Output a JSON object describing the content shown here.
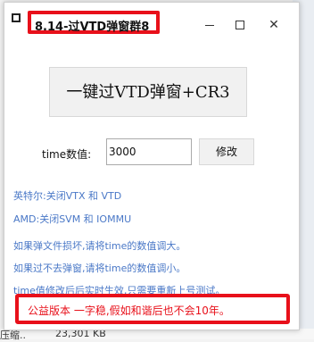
{
  "window": {
    "title": "8.14-过VTD弹窗群8",
    "minimize_icon": "minimize-icon",
    "maximize_icon": "maximize-icon",
    "close_icon": "close-icon",
    "close_glyph": "✕"
  },
  "main": {
    "bypass_button_label": "一键过VTD弹窗+CR3",
    "time_label": "time数值:",
    "time_value": "3000",
    "modify_button_label": "修改"
  },
  "instructions": [
    "英特尔:关闭VTX 和 VTD",
    "AMD:关闭SVM 和 IOMMU",
    "如果弹文件损坏,请将time的数值调大。",
    "如果过不去弹窗,请将time的数值调小。",
    "time值修改后后实时生效,只需要重新上号测试。"
  ],
  "notice": "公益版本 一字稳,假如和谐后也不会10年。",
  "background": {
    "left_fragment": "压缩..",
    "size_text": "23,301 KB"
  },
  "colors": {
    "accent_red": "#e8101a",
    "info_blue": "#4a78c7"
  }
}
